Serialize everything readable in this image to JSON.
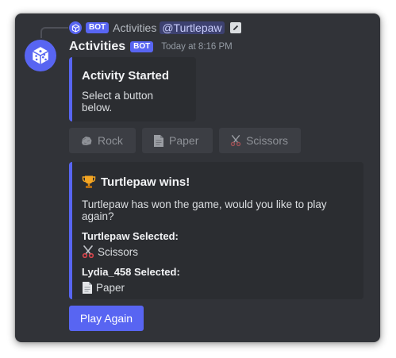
{
  "reply": {
    "bot_tag": "BOT",
    "name": "Activities",
    "mention": "@Turtlepaw"
  },
  "message": {
    "username": "Activities",
    "bot_tag": "BOT",
    "timestamp": "Today at 8:16 PM"
  },
  "embed_started": {
    "title": "Activity Started",
    "description": "Select a button below."
  },
  "buttons": [
    {
      "label": "Rock",
      "icon": "rock-icon",
      "disabled": true
    },
    {
      "label": "Paper",
      "icon": "paper-icon",
      "disabled": true
    },
    {
      "label": "Scissors",
      "icon": "scissors-icon",
      "disabled": true
    }
  ],
  "embed_result": {
    "title": "Turtlepaw wins!",
    "description": "Turtlepaw has won the game, would you like to play again?",
    "fields": [
      {
        "name": "Turtlepaw Selected:",
        "value": "Scissors",
        "icon": "scissors-icon"
      },
      {
        "name": "Lydia_458 Selected:",
        "value": "Paper",
        "icon": "paper-icon"
      }
    ]
  },
  "play_again_label": "Play Again",
  "colors": {
    "accent": "#5865f2",
    "background": "#313338",
    "embed": "#2b2d31"
  }
}
